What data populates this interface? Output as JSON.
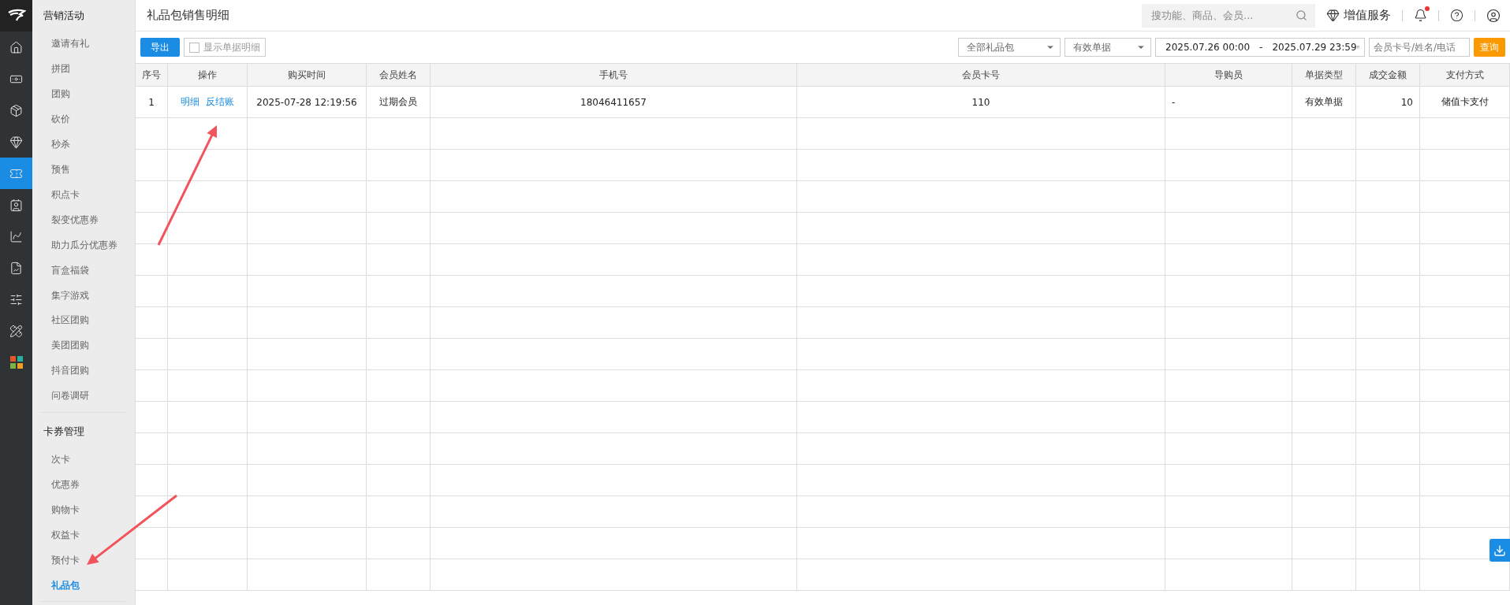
{
  "rail": {
    "items": [
      {
        "kind": "home",
        "selected": false
      },
      {
        "kind": "money",
        "selected": false
      },
      {
        "kind": "box",
        "selected": false
      },
      {
        "kind": "diamond",
        "selected": false
      },
      {
        "kind": "ticket",
        "selected": true
      },
      {
        "kind": "card",
        "selected": false
      },
      {
        "kind": "chart",
        "selected": false
      },
      {
        "kind": "report",
        "selected": false
      },
      {
        "kind": "sliders",
        "selected": false
      },
      {
        "kind": "tools",
        "selected": false
      },
      {
        "kind": "apps",
        "selected": false
      }
    ]
  },
  "sidebar": {
    "groups": [
      {
        "title": "营销活动",
        "items": [
          {
            "label": "邀请有礼",
            "selected": false
          },
          {
            "label": "拼团",
            "selected": false
          },
          {
            "label": "团购",
            "selected": false
          },
          {
            "label": "砍价",
            "selected": false
          },
          {
            "label": "秒杀",
            "selected": false
          },
          {
            "label": "预售",
            "selected": false
          },
          {
            "label": "积点卡",
            "selected": false
          },
          {
            "label": "裂变优惠券",
            "selected": false
          },
          {
            "label": "助力瓜分优惠券",
            "selected": false
          },
          {
            "label": "盲盒福袋",
            "selected": false
          },
          {
            "label": "集字游戏",
            "selected": false
          },
          {
            "label": "社区团购",
            "selected": false
          },
          {
            "label": "美团团购",
            "selected": false
          },
          {
            "label": "抖音团购",
            "selected": false
          },
          {
            "label": "问卷调研",
            "selected": false
          }
        ]
      },
      {
        "title": "卡券管理",
        "items": [
          {
            "label": "次卡",
            "selected": false
          },
          {
            "label": "优惠券",
            "selected": false
          },
          {
            "label": "购物卡",
            "selected": false
          },
          {
            "label": "权益卡",
            "selected": false
          },
          {
            "label": "预付卡",
            "selected": false
          },
          {
            "label": "礼品包",
            "selected": true
          }
        ]
      }
    ]
  },
  "header": {
    "title": "礼品包销售明细",
    "search": {
      "placeholder": "搜功能、商品、会员..."
    },
    "service": "增值服务",
    "notification_dot": true
  },
  "toolbar": {
    "export": "导出",
    "show_detail": {
      "label": "显示单据明细",
      "checked": false
    },
    "package_select": "全部礼品包",
    "status_select": "有效单据",
    "date_from": "2025.07.26 00:00",
    "date_sep": "-",
    "date_to": "2025.07.29 23:59",
    "member_field": {
      "placeholder": "会员卡号/姓名/电话"
    },
    "query": "查询"
  },
  "table": {
    "columns": [
      "序号",
      "操作",
      "购买时间",
      "会员姓名",
      "手机号",
      "会员卡号",
      "导购员",
      "单据类型",
      "成交金额",
      "支付方式"
    ],
    "rows": [
      {
        "index": "1",
        "actions": [
          "明细",
          "反结账"
        ],
        "time": "2025-07-28 12:19:56",
        "name": "过期会员",
        "phone": "18046411657",
        "card": "110",
        "guide": "-",
        "type": "有效单据",
        "amount": "10",
        "payment": "储值卡支付"
      }
    ]
  }
}
